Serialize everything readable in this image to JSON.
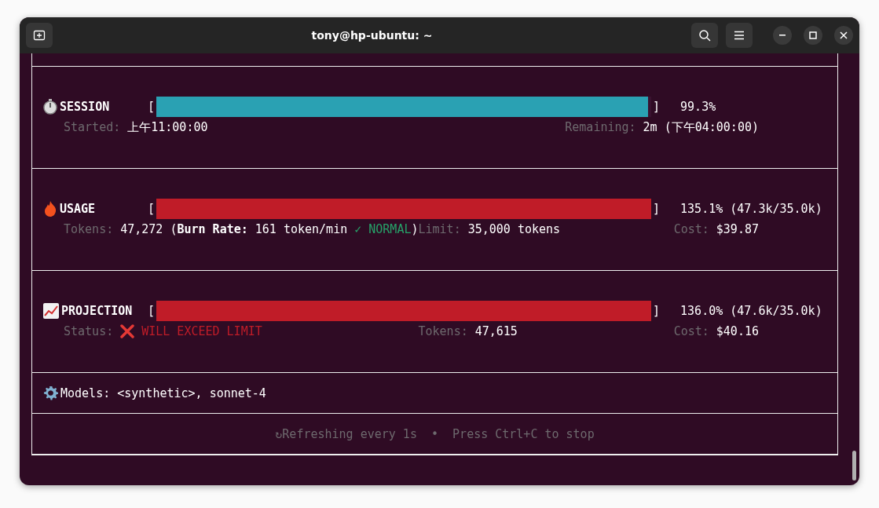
{
  "window": {
    "title": "tony@hp-ubuntu: ~"
  },
  "sections": [
    {
      "kind": "meter",
      "title": "SESSION",
      "bar": {
        "open": "[",
        "level": 0.993,
        "color": "#2aa1b3",
        "close": "]"
      },
      "reading": "99.3%",
      "fields": [
        {
          "parts": [
            {
              "kind": "label",
              "text": "Started:"
            },
            {
              "kind": "value",
              "text": "上午11:00:00"
            }
          ]
        },
        {
          "parts": [
            {
              "kind": "label",
              "text": "Remaining:"
            },
            {
              "kind": "value",
              "text": "2m (下午04:00:00)"
            }
          ]
        }
      ]
    },
    {
      "kind": "meter",
      "title": "USAGE",
      "bar": {
        "open": "[",
        "level": 1,
        "color": "#c01c28",
        "close": "]"
      },
      "reading": "135.1% (47.3k/35.0k)",
      "fields": [
        {
          "parts": [
            {
              "kind": "label",
              "text": "Tokens:"
            },
            {
              "kind": "value",
              "text": "47,272 (**Burn Rate:** 161 token/min"
            },
            {
              "kind": "ok",
              "text": "✓ NORMAL"
            },
            {
              "kind": "value",
              "text": ")",
              "attached": true
            },
            {
              "kind": "label",
              "text": "Limit:"
            },
            {
              "kind": "value",
              "text": "35,000 tokens"
            }
          ]
        },
        {
          "parts": [
            {
              "kind": "label",
              "text": "Cost:"
            },
            {
              "kind": "value",
              "text": "$39.87"
            }
          ]
        }
      ]
    },
    {
      "kind": "meter",
      "title": "PROJECTION",
      "bar": {
        "open": "[",
        "level": 1,
        "color": "#c01c28",
        "close": "]"
      },
      "reading": "136.0% (47.6k/35.0k)",
      "fields": [
        {
          "parts": [
            {
              "kind": "label",
              "text": "Status:"
            },
            {
              "kind": "cross"
            },
            {
              "kind": "alert",
              "text": "WILL EXCEED LIMIT"
            }
          ]
        },
        {
          "parts": [
            {
              "kind": "label",
              "text": "Tokens:"
            },
            {
              "kind": "value",
              "text": "47,615"
            }
          ]
        },
        {
          "parts": [
            {
              "kind": "label",
              "text": "Cost:"
            },
            {
              "kind": "value",
              "text": "$40.16"
            }
          ]
        }
      ]
    },
    {
      "kind": "line",
      "text": "Models: <synthetic>, sonnet-4"
    },
    {
      "kind": "footer",
      "text": "↻Refreshing every 1s  •  Press Ctrl+C to stop"
    }
  ]
}
